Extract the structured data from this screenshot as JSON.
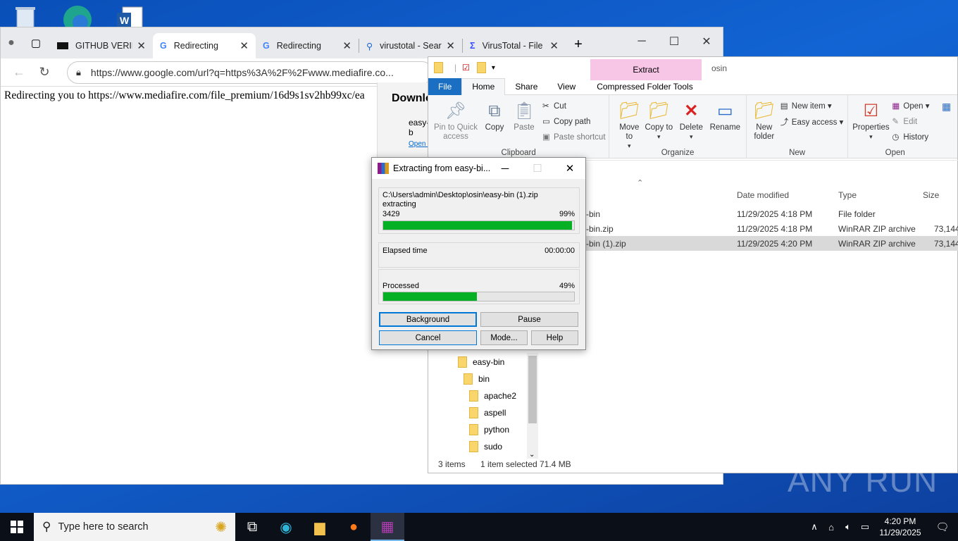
{
  "browser": {
    "tabs": [
      {
        "title": "GITHUB VERIFE",
        "active": false
      },
      {
        "title": "Redirecting",
        "active": true
      },
      {
        "title": "Redirecting",
        "active": false
      },
      {
        "title": "virustotal - Sear",
        "active": false
      },
      {
        "title": "VirusTotal - File",
        "active": false
      }
    ],
    "url": "https://www.google.com/url?q=https%3A%2F%2Fwww.mediafire.co...",
    "page_text": "Redirecting you to https://www.mediafire.com/file_premium/16d9s1sv2hb99xc/ea",
    "downloads": {
      "header": "Downlo",
      "item": "easy-b",
      "open_link": "Open f"
    }
  },
  "explorer": {
    "title": "osin",
    "context_tab": "Extract",
    "tabs": [
      "File",
      "Home",
      "Share",
      "View",
      "Compressed Folder Tools"
    ],
    "clipboard": {
      "pin": "Pin to Quick access",
      "copy": "Copy",
      "paste": "Paste",
      "cut": "Cut",
      "copy_path": "Copy path",
      "paste_shortcut": "Paste shortcut",
      "group": "Clipboard"
    },
    "organize": {
      "move_to": "Move to",
      "copy_to": "Copy to",
      "delete": "Delete",
      "rename": "Rename",
      "group": "Organize"
    },
    "new": {
      "new_folder": "New folder",
      "new_item": "New item",
      "easy_access": "Easy access",
      "group": "New"
    },
    "open": {
      "properties": "Properties",
      "open": "Open",
      "edit": "Edit",
      "history": "History",
      "group": "Open"
    },
    "columns": {
      "date": "Date modified",
      "type": "Type",
      "size": "Size"
    },
    "files": [
      {
        "name": "-bin",
        "date": "11/29/2025 4:18 PM",
        "type": "File folder",
        "size": "",
        "selected": false
      },
      {
        "name": "-bin.zip",
        "date": "11/29/2025 4:18 PM",
        "type": "WinRAR ZIP archive",
        "size": "73,144",
        "selected": false
      },
      {
        "name": "-bin (1).zip",
        "date": "11/29/2025 4:20 PM",
        "type": "WinRAR ZIP archive",
        "size": "73,144",
        "selected": true
      }
    ],
    "tree": [
      "easy-bin",
      "bin",
      "apache2",
      "aspell",
      "python",
      "sudo"
    ],
    "status": {
      "items": "3 items",
      "selected": "1 item selected",
      "size": "71.4 MB"
    }
  },
  "rar": {
    "title": "Extracting from easy-bi...",
    "path": "C:\\Users\\admin\\Desktop\\osin\\easy-bin (1).zip",
    "action": "extracting",
    "file_num": "3429",
    "file_pct": "99%",
    "file_progress": 0.99,
    "elapsed_label": "Elapsed time",
    "elapsed": "00:00:00",
    "processed_label": "Processed",
    "processed_pct": "49%",
    "processed_progress": 0.49,
    "buttons": {
      "background": "Background",
      "pause": "Pause",
      "cancel": "Cancel",
      "mode": "Mode...",
      "help": "Help"
    }
  },
  "taskbar": {
    "search_placeholder": "Type here to search",
    "time": "4:20 PM",
    "date": "11/29/2025"
  },
  "watermark": "ANY RUN"
}
